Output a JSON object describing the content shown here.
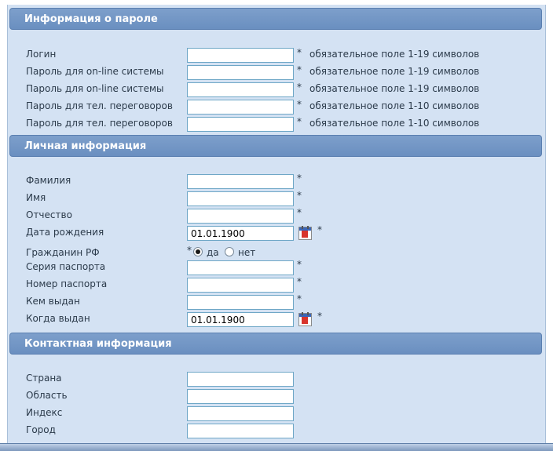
{
  "sections": {
    "password": {
      "title": "Информация о пароле"
    },
    "personal": {
      "title": "Личная информация"
    },
    "contact": {
      "title": "Контактная информация"
    }
  },
  "password_fields": [
    {
      "label": "Логин",
      "value": "",
      "required": "*",
      "hint": "обязательное поле 1-19 символов"
    },
    {
      "label": "Пароль для on-line системы",
      "value": "",
      "required": "*",
      "hint": "обязательное поле 1-19 символов"
    },
    {
      "label": "Пароль для on-line системы",
      "value": "",
      "required": "*",
      "hint": "обязательное поле 1-19 символов"
    },
    {
      "label": "Пароль для тел. переговоров",
      "value": "",
      "required": "*",
      "hint": "обязательное поле 1-10 символов"
    },
    {
      "label": "Пароль для тел. переговоров",
      "value": "",
      "required": "*",
      "hint": "обязательное поле 1-10 символов"
    }
  ],
  "personal_fields": [
    {
      "label": "Фамилия",
      "value": "",
      "required": "*"
    },
    {
      "label": "Имя",
      "value": "",
      "required": "*"
    },
    {
      "label": "Отчество",
      "value": "",
      "required": "*"
    },
    {
      "label": "Дата рождения",
      "value": "01.01.1900",
      "required": "*"
    }
  ],
  "citizen": {
    "label": "Гражданин РФ",
    "required": "*",
    "options": [
      {
        "label": "да",
        "checked": true
      },
      {
        "label": "нет",
        "checked": false
      }
    ]
  },
  "passport_fields": [
    {
      "label": "Серия паспорта",
      "value": "",
      "required": "*"
    },
    {
      "label": "Номер паспорта",
      "value": "",
      "required": "*"
    },
    {
      "label": "Кем выдан",
      "value": "",
      "required": "*"
    },
    {
      "label": "Когда выдан",
      "value": "01.01.1900",
      "required": "*"
    }
  ],
  "contact_fields": [
    {
      "label": "Страна",
      "value": ""
    },
    {
      "label": "Область",
      "value": ""
    },
    {
      "label": "Индекс",
      "value": ""
    },
    {
      "label": "Город",
      "value": ""
    }
  ],
  "icons": {
    "calendar": "calendar-icon"
  },
  "colors": {
    "header_bg": "#6a8fc0",
    "panel_bg": "#d4e2f3",
    "field_border": "#6fa7c7"
  }
}
